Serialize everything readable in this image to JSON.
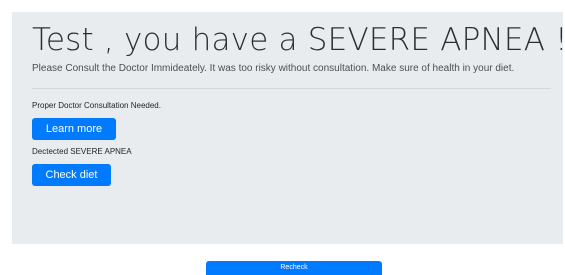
{
  "result": {
    "title": "Test , you have a SEVERE APNEA !",
    "lead": "Please Consult the Doctor Immideately. It was too risky without consultation. Make sure of health in your diet.",
    "consult_note": "Proper Doctor Consultation Needed.",
    "learn_more_label": "Learn more",
    "detected_note": "Dectected SEVERE APNEA",
    "check_diet_label": "Check diet"
  },
  "footer": {
    "recheck_label": "Recheck"
  },
  "colors": {
    "primary": "#007bff",
    "panel_background": "#e9ecef"
  }
}
